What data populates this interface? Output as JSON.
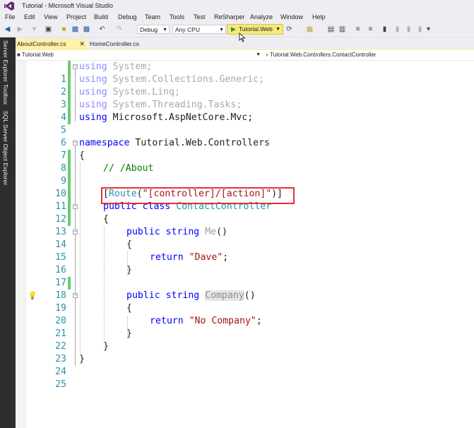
{
  "window": {
    "title": "Tutorial - Microsoft Visual Studio"
  },
  "menu": [
    "File",
    "Edit",
    "View",
    "Project",
    "Build",
    "Debug",
    "Team",
    "Tools",
    "Test",
    "ReSharper",
    "Analyze",
    "Window",
    "Help"
  ],
  "toolbar": {
    "configuration": "Debug",
    "platform": "Any CPU",
    "start_label": "Tutorial.Web"
  },
  "side_tabs": [
    "Server Explorer",
    "Toolbox",
    "SQL Server Object Explorer"
  ],
  "tabs": {
    "active": "AboutController.cs",
    "other": "HomeController.cs"
  },
  "navbar": {
    "project": "Tutorial.Web",
    "scope": "Tutorial.Web.Controllers.ContactController"
  },
  "code": {
    "l1": "using",
    "l1b": " System;",
    "l2": "using",
    "l2b": " System.Collections.Generic;",
    "l3": "using",
    "l3b": " System.Linq;",
    "l4": "using",
    "l4b": " System.Threading.Tasks;",
    "l5": "using",
    "l5b": " Microsoft.AspNetCore.Mvc;",
    "l7": "namespace",
    "l7b": " Tutorial.Web.Controllers",
    "l8": "{",
    "l9": "// /About",
    "l11a": "[",
    "l11b": "Route",
    "l11c": "(",
    "l11d": "\"[controller]/[action]\"",
    "l11e": ")]",
    "l12a": "public",
    "l12b": " ",
    "l12c": "class",
    "l12d": " ",
    "l12e": "ContactController",
    "l13": "{",
    "l14a": "public",
    "l14b": " ",
    "l14c": "string",
    "l14d": " ",
    "l14e": "Me",
    "l14f": "()",
    "l15": "{",
    "l16a": "return",
    "l16b": " ",
    "l16c": "\"Dave\"",
    "l16d": ";",
    "l17": "}",
    "l19a": "public",
    "l19b": " ",
    "l19c": "string",
    "l19d": " ",
    "l19e": "Company",
    "l19f": "()",
    "l20": "{",
    "l21a": "return",
    "l21b": " ",
    "l21c": "\"No Company\"",
    "l21d": ";",
    "l22": "}",
    "l23": "}",
    "l24": "}"
  },
  "line_numbers": [
    "1",
    "2",
    "3",
    "4",
    "5",
    "6",
    "7",
    "8",
    "9",
    "10",
    "11",
    "12",
    "13",
    "14",
    "15",
    "16",
    "17",
    "18",
    "19",
    "20",
    "21",
    "22",
    "23",
    "24",
    "25"
  ]
}
